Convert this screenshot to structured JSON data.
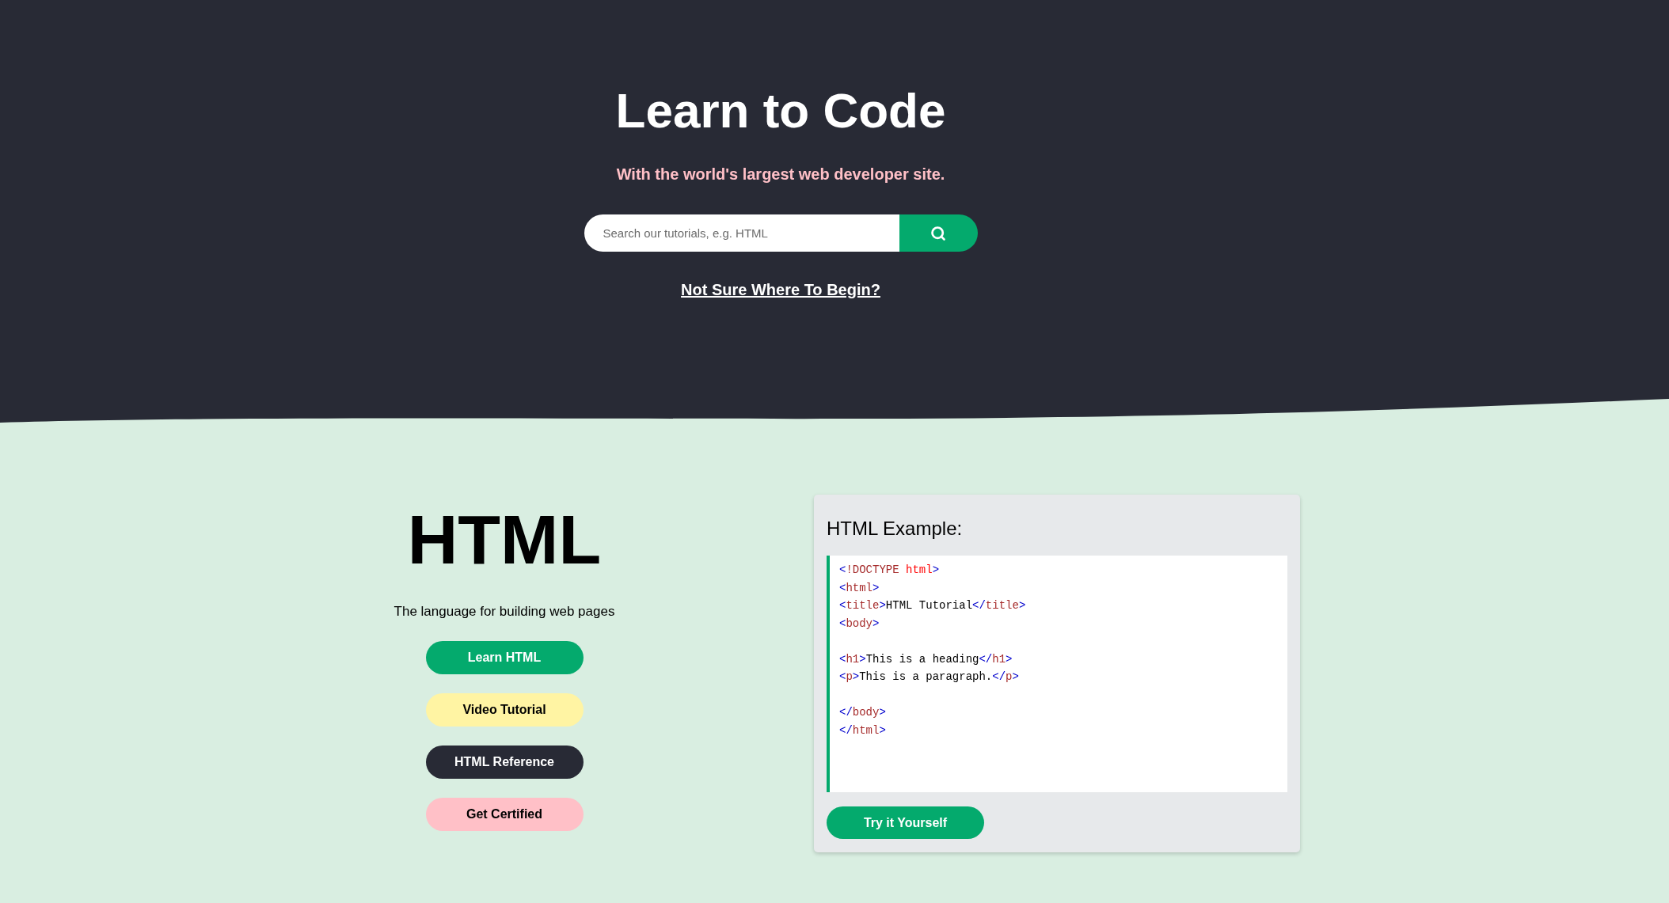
{
  "hero": {
    "title": "Learn to Code",
    "subtitle": "With the world's largest web developer site.",
    "search": {
      "placeholder": "Search our tutorials, e.g. HTML"
    },
    "link": "Not Sure Where To Begin?"
  },
  "course": {
    "title": "HTML",
    "tagline": "The language for building web pages",
    "buttons": [
      {
        "label": "Learn HTML",
        "kind": "primary"
      },
      {
        "label": "Video Tutorial",
        "kind": "highlight"
      },
      {
        "label": "HTML Reference",
        "kind": "dark"
      },
      {
        "label": "Get Certified",
        "kind": "accent"
      }
    ]
  },
  "example": {
    "title": "HTML Example:",
    "code_lines": [
      {
        "kind": "code",
        "tokens": [
          {
            "text": "<",
            "kind": "bracket"
          },
          {
            "text": "!DOCTYPE",
            "kind": "tag"
          },
          {
            "text": " html",
            "kind": "attr"
          },
          {
            "text": ">",
            "kind": "bracket"
          }
        ]
      },
      {
        "kind": "code",
        "tokens": [
          {
            "text": "<",
            "kind": "bracket"
          },
          {
            "text": "html",
            "kind": "tag"
          },
          {
            "text": ">",
            "kind": "bracket"
          }
        ]
      },
      {
        "kind": "code",
        "tokens": [
          {
            "text": "<",
            "kind": "bracket"
          },
          {
            "text": "title",
            "kind": "tag"
          },
          {
            "text": ">",
            "kind": "bracket"
          },
          {
            "text": "HTML Tutorial",
            "kind": "text"
          },
          {
            "text": "</",
            "kind": "bracket"
          },
          {
            "text": "title",
            "kind": "tag"
          },
          {
            "text": ">",
            "kind": "bracket"
          }
        ]
      },
      {
        "kind": "code",
        "tokens": [
          {
            "text": "<",
            "kind": "bracket"
          },
          {
            "text": "body",
            "kind": "tag"
          },
          {
            "text": ">",
            "kind": "bracket"
          }
        ]
      },
      {
        "kind": "blank"
      },
      {
        "kind": "code",
        "tokens": [
          {
            "text": "<",
            "kind": "bracket"
          },
          {
            "text": "h1",
            "kind": "tag"
          },
          {
            "text": ">",
            "kind": "bracket"
          },
          {
            "text": "This is a heading",
            "kind": "text"
          },
          {
            "text": "</",
            "kind": "bracket"
          },
          {
            "text": "h1",
            "kind": "tag"
          },
          {
            "text": ">",
            "kind": "bracket"
          }
        ]
      },
      {
        "kind": "code",
        "tokens": [
          {
            "text": "<",
            "kind": "bracket"
          },
          {
            "text": "p",
            "kind": "tag"
          },
          {
            "text": ">",
            "kind": "bracket"
          },
          {
            "text": "This is a paragraph.",
            "kind": "text"
          },
          {
            "text": "</",
            "kind": "bracket"
          },
          {
            "text": "p",
            "kind": "tag"
          },
          {
            "text": ">",
            "kind": "bracket"
          }
        ]
      },
      {
        "kind": "blank"
      },
      {
        "kind": "code",
        "tokens": [
          {
            "text": "</",
            "kind": "bracket"
          },
          {
            "text": "body",
            "kind": "tag"
          },
          {
            "text": ">",
            "kind": "bracket"
          }
        ]
      },
      {
        "kind": "code",
        "tokens": [
          {
            "text": "</",
            "kind": "bracket"
          },
          {
            "text": "html",
            "kind": "tag"
          },
          {
            "text": ">",
            "kind": "bracket"
          }
        ]
      }
    ],
    "button": "Try it Yourself"
  }
}
